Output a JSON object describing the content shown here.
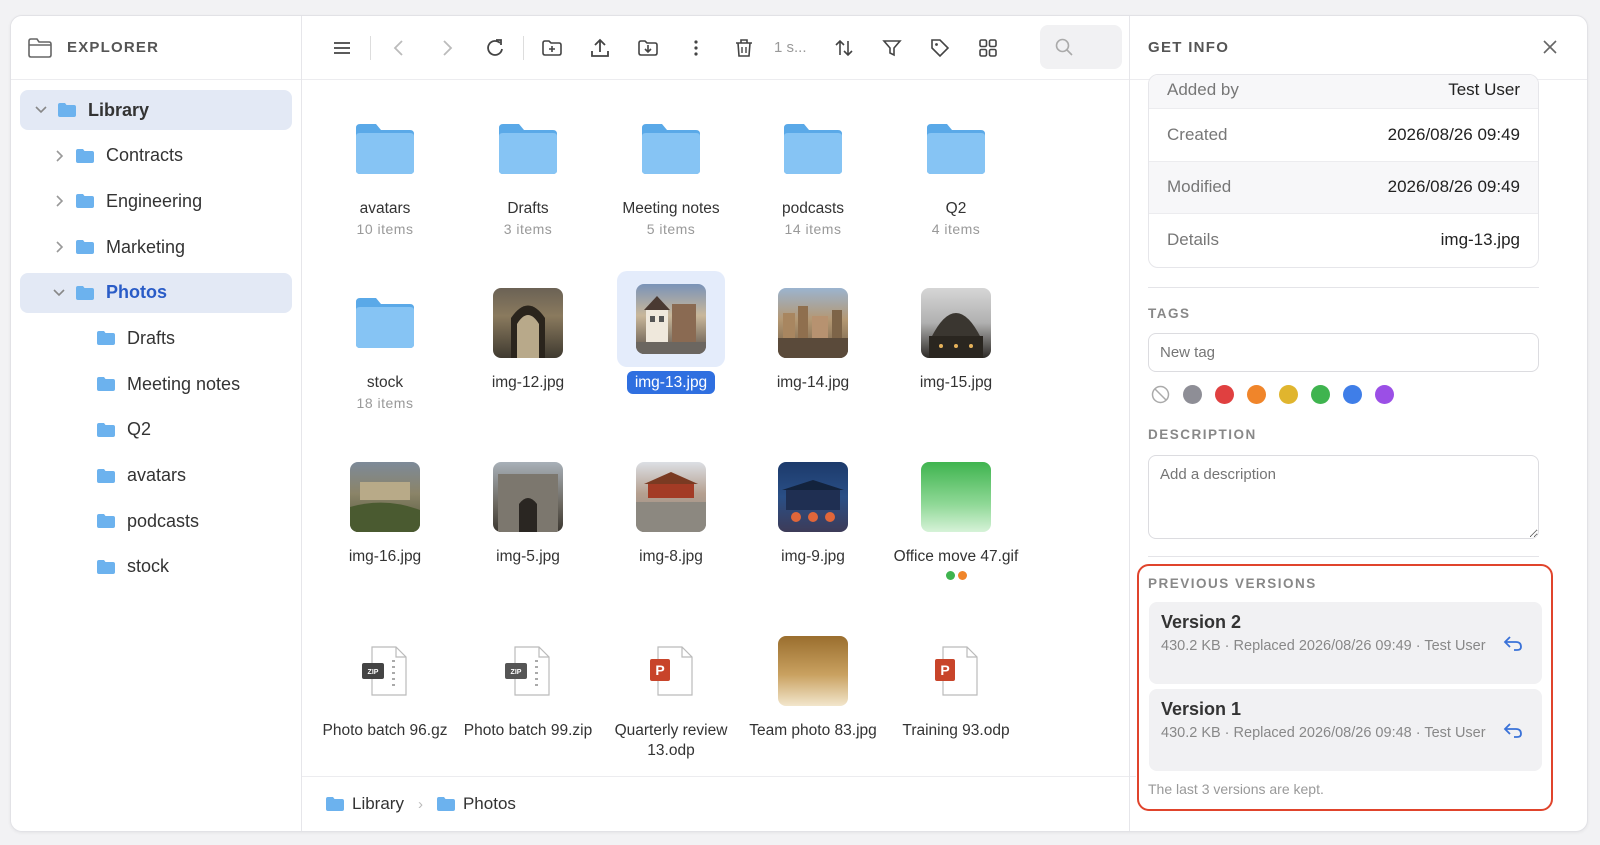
{
  "sidebar": {
    "title": "EXPLORER",
    "items": [
      {
        "label": "Library"
      },
      {
        "label": "Contracts"
      },
      {
        "label": "Engineering"
      },
      {
        "label": "Marketing"
      },
      {
        "label": "Photos"
      },
      {
        "label": "Drafts"
      },
      {
        "label": "Meeting notes"
      },
      {
        "label": "Q2"
      },
      {
        "label": "avatars"
      },
      {
        "label": "podcasts"
      },
      {
        "label": "stock"
      }
    ]
  },
  "toolbar": {
    "selection_count": "1 s..."
  },
  "grid": {
    "items": [
      {
        "name": "avatars",
        "sub": "10 items"
      },
      {
        "name": "Drafts",
        "sub": "3 items"
      },
      {
        "name": "Meeting notes",
        "sub": "5 items"
      },
      {
        "name": "podcasts",
        "sub": "14 items"
      },
      {
        "name": "Q2",
        "sub": "4 items"
      },
      {
        "name": "stock",
        "sub": "18 items"
      },
      {
        "name": "img-12.jpg"
      },
      {
        "name": "img-13.jpg"
      },
      {
        "name": "img-14.jpg"
      },
      {
        "name": "img-15.jpg"
      },
      {
        "name": "img-16.jpg"
      },
      {
        "name": "img-5.jpg"
      },
      {
        "name": "img-8.jpg"
      },
      {
        "name": "img-9.jpg"
      },
      {
        "name": "Office move 47.gif"
      },
      {
        "name": "Photo batch 96.gz"
      },
      {
        "name": "Photo batch 99.zip"
      },
      {
        "name": "Quarterly review 13.odp"
      },
      {
        "name": "Team photo 83.jpg"
      },
      {
        "name": "Training 93.odp"
      }
    ]
  },
  "breadcrumb": [
    {
      "label": "Library"
    },
    {
      "label": "Photos"
    }
  ],
  "info": {
    "title": "GET INFO",
    "properties": [
      {
        "key": "Added by",
        "value": "Test User"
      },
      {
        "key": "Created",
        "value": "2026/08/26 09:49"
      },
      {
        "key": "Modified",
        "value": "2026/08/26 09:49"
      },
      {
        "key": "Details",
        "value": "img-13.jpg"
      }
    ],
    "tags_title": "TAGS",
    "tag_placeholder": "New tag",
    "tag_colors": [
      "#8e8e96",
      "#e04040",
      "#f0852a",
      "#e0b52e",
      "#3fb44f",
      "#3f7ee8",
      "#9b4fe6"
    ],
    "description_title": "DESCRIPTION",
    "description_placeholder": "Add a description",
    "versions_title": "PREVIOUS VERSIONS",
    "versions": [
      {
        "title": "Version 2",
        "meta": "430.2 KB · Replaced 2026/08/26 09:49 · Test User"
      },
      {
        "title": "Version 1",
        "meta": "430.2 KB · Replaced 2026/08/26 09:48 · Test User"
      }
    ],
    "versions_note": "The last 3 versions are kept."
  },
  "colors": {
    "accent": "#2f6fe0",
    "highlight_border": "#e0442c",
    "folder": "#7fbdf0"
  }
}
